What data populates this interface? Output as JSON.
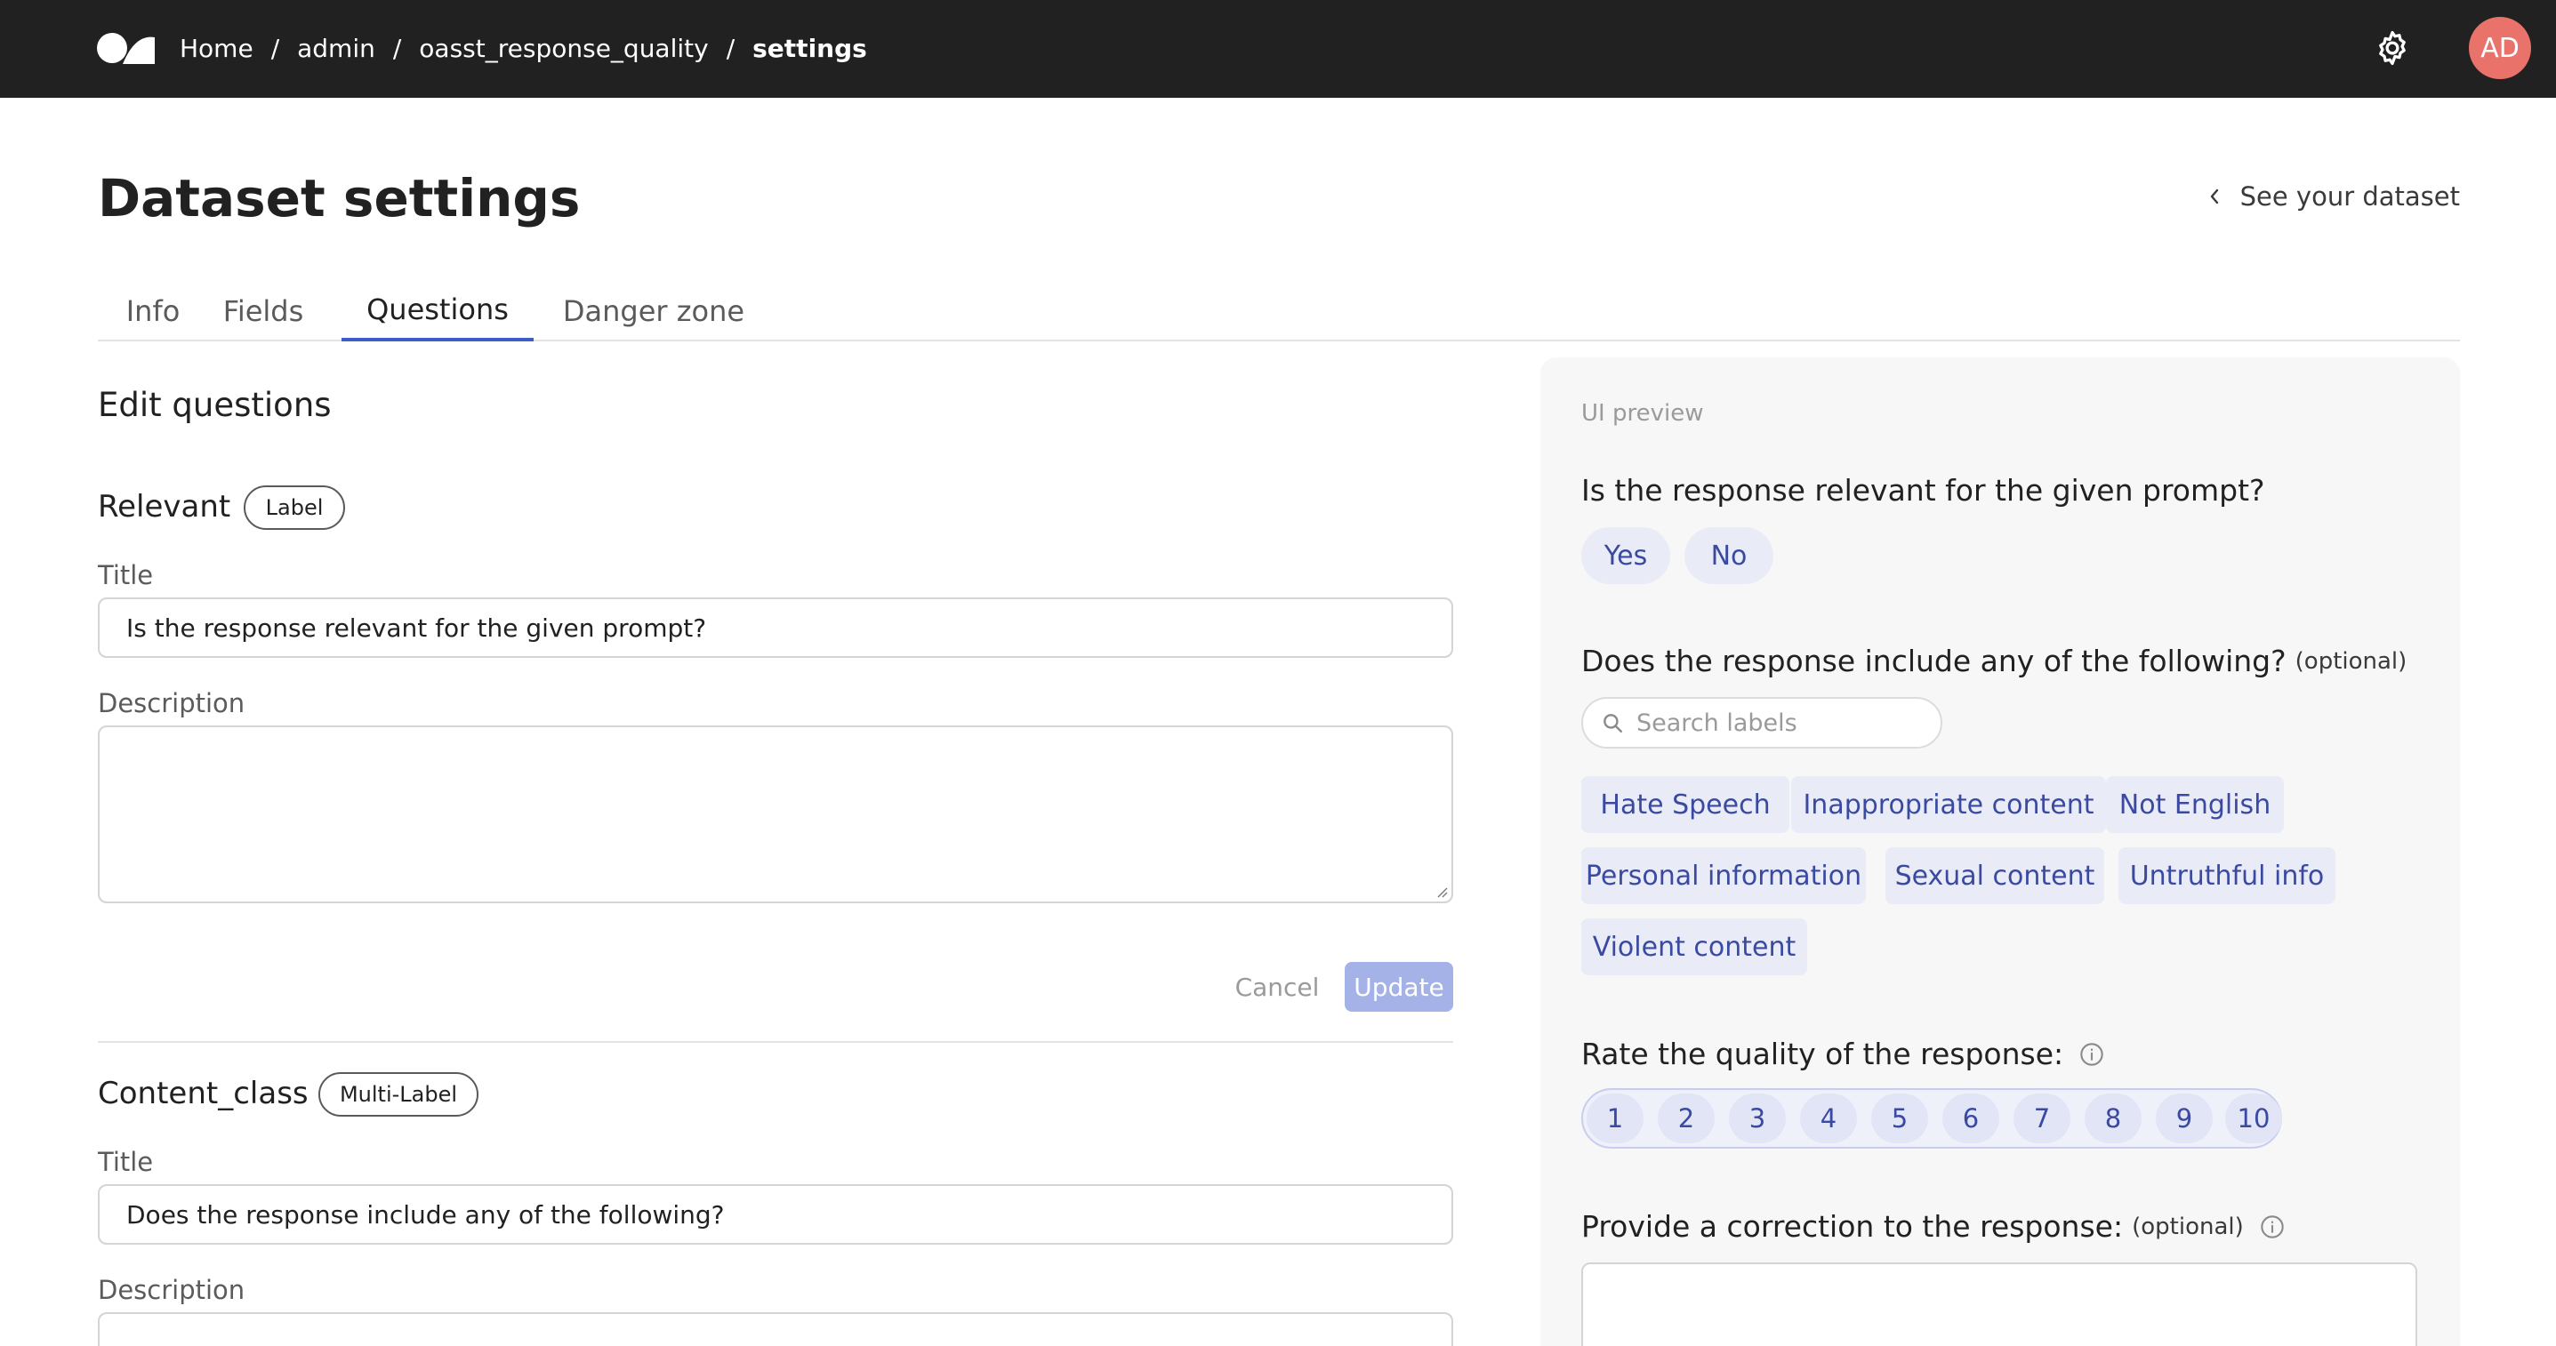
{
  "topbar": {
    "breadcrumb": [
      {
        "label": "Home"
      },
      {
        "label": "admin"
      },
      {
        "label": "oasst_response_quality"
      },
      {
        "label": "settings"
      }
    ],
    "separator": "/",
    "avatar_initials": "AD",
    "icons": {
      "logo": "brand-logo",
      "settings": "gear-icon"
    }
  },
  "header": {
    "title": "Dataset settings",
    "see_dataset_label": "See your dataset"
  },
  "tabs": [
    {
      "label": "Info",
      "active": false
    },
    {
      "label": "Fields",
      "active": false
    },
    {
      "label": "Questions",
      "active": true
    },
    {
      "label": "Danger zone",
      "active": false
    }
  ],
  "edit": {
    "section_title": "Edit questions",
    "questions": [
      {
        "name": "Relevant",
        "type_badge": "Label",
        "title_label": "Title",
        "title_value": "Is the response relevant for the given prompt?",
        "description_label": "Description",
        "description_value": "",
        "cancel_label": "Cancel",
        "update_label": "Update"
      },
      {
        "name": "Content_class",
        "type_badge": "Multi-Label",
        "title_label": "Title",
        "title_value": "Does the response include any of the following?",
        "description_label": "Description",
        "description_value": ""
      }
    ]
  },
  "preview": {
    "label": "UI preview",
    "q1": {
      "title": "Is the response relevant for the given prompt?",
      "options": [
        "Yes",
        "No"
      ]
    },
    "q2": {
      "title": "Does the response include any of the following?",
      "optional": "(optional)",
      "search_placeholder": "Search labels",
      "labels": [
        "Hate Speech",
        "Inappropriate content",
        "Not English",
        "Personal information",
        "Sexual content",
        "Untruthful info",
        "Violent content"
      ]
    },
    "q3": {
      "title": "Rate the quality of the response:",
      "ratings": [
        "1",
        "2",
        "3",
        "4",
        "5",
        "6",
        "7",
        "8",
        "9",
        "10"
      ]
    },
    "q4": {
      "title": "Provide a correction to the response:",
      "optional": "(optional)"
    }
  },
  "colors": {
    "topbar_bg": "#212121",
    "accent": "#3e5cc5",
    "avatar_bg": "#e9726a",
    "chip_bg": "#e9ebf7",
    "chip_text": "#3a4aa0",
    "update_button_bg": "#a5b2e8"
  }
}
